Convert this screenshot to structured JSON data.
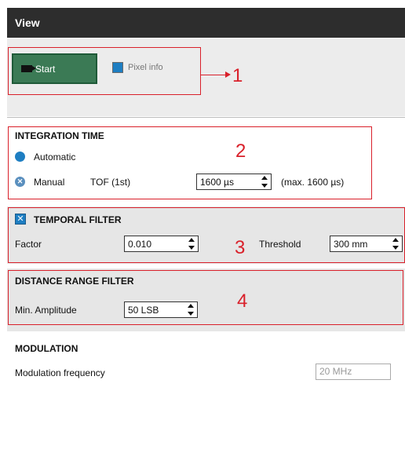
{
  "header": {
    "title": "View"
  },
  "toolbar": {
    "start_label": "Start",
    "pixel_info_label": "Pixel info",
    "pixel_info_checked": true
  },
  "annotations": [
    "1",
    "2",
    "3",
    "4"
  ],
  "integration_time": {
    "title": "INTEGRATION TIME",
    "automatic_label": "Automatic",
    "manual_label": "Manual",
    "tof_label": "TOF (1st)",
    "value": "1600 µs",
    "max_label": "(max. 1600 µs)",
    "selected_mode": "Manual"
  },
  "temporal_filter": {
    "title": "TEMPORAL FILTER",
    "enabled": true,
    "factor_label": "Factor",
    "factor_value": "0.010",
    "threshold_label": "Threshold",
    "threshold_value": "300 mm"
  },
  "distance_range_filter": {
    "title": "DISTANCE RANGE FILTER",
    "min_amplitude_label": "Min. Amplitude",
    "min_amplitude_value": "50 LSB"
  },
  "modulation": {
    "title": "MODULATION",
    "frequency_label": "Modulation frequency",
    "frequency_value": "20 MHz"
  },
  "colors": {
    "header_bg": "#2d2d2d",
    "start_button": "#3b7a55",
    "accent_blue": "#1e7ec2",
    "annotation_red": "#d9202a"
  }
}
